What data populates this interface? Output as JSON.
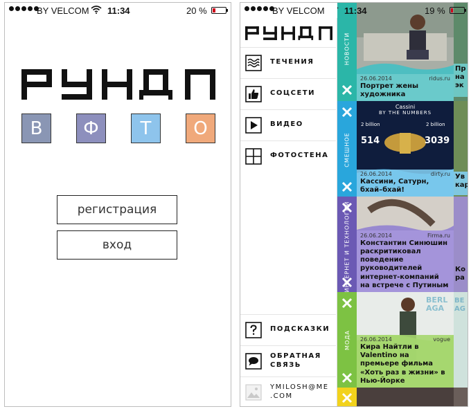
{
  "status_left": {
    "carrier": "BY VELCOM",
    "time": "11:34",
    "battery_pct": "20 %",
    "battery_level": 0.2,
    "battery_color": "#d0021b"
  },
  "status_right": {
    "carrier": "BY VELCOM",
    "time": "11:34",
    "battery_pct": "19 %"
  },
  "login": {
    "logo": "РУНДЛ",
    "social": [
      {
        "letter": "В",
        "color": "#8a96b4"
      },
      {
        "letter": "Ф",
        "color": "#8d8fbd"
      },
      {
        "letter": "Т",
        "color": "#8ec4ec"
      },
      {
        "letter": "О",
        "color": "#f0a97b"
      }
    ],
    "register_label": "регистрация",
    "login_label": "вход"
  },
  "menu": {
    "logo": "РУНДЛ",
    "items": [
      {
        "label": "ТЕЧЕНИЯ",
        "icon": "waves-icon"
      },
      {
        "label": "СОЦСЕТИ",
        "icon": "thumbs-up-icon"
      },
      {
        "label": "ВИДЕО",
        "icon": "play-icon"
      },
      {
        "label": "ФОТОСТЕНА",
        "icon": "photo-grid-icon"
      }
    ],
    "bottom": [
      {
        "label": "ПОДСКАЗКИ",
        "icon": "question-icon"
      },
      {
        "label": "ОБРАТНАЯ\nСВЯЗЬ",
        "icon": "chat-bubble-icon"
      },
      {
        "label": "YMILOSH@ME\n.COM",
        "icon": "avatar-placeholder-icon"
      }
    ]
  },
  "feed": {
    "sections": [
      {
        "name": "НОВОСТИ",
        "color": "#2bb6a8",
        "card": {
          "date": "26.06.2014",
          "source": "ridus.ru",
          "title": "Портрет жены художника"
        },
        "peek": "Пр\nна\nэк"
      },
      {
        "name": "СМЕШНОЕ",
        "color": "#29a6dc",
        "card": {
          "date": "26.06.2014",
          "source": "dirty.ru",
          "title": "Кассини, Сатурн, бхай–бхай!",
          "infographic": {
            "head": "Cassini",
            "sub": "BY THE NUMBERS",
            "n1": "514",
            "n2": "3039",
            "n3": "2 billion",
            "n4": "2 billion"
          }
        },
        "peek": "Ув\nкар"
      },
      {
        "name": "ИНТЕРНЕТ И ТЕХНОЛОГИИ",
        "color": "#6b59b4",
        "card": {
          "date": "26.06.2014",
          "source": "Firma.ru",
          "title": "Константин Синюшин раскритиковал поведение руководителей интернет-компаний на встрече с Путиным"
        },
        "peek": "Ко\nра"
      },
      {
        "name": "МОДА",
        "color": "#7dc243",
        "card": {
          "date": "26.06.2014",
          "source": "vogue",
          "title": "Кира Найтли в Valentino на премьере фильма «Хоть раз в жизни» в Нью-Йорке",
          "backdrop": "BERL\nAGA"
        },
        "peek": "BE\nAG"
      },
      {
        "name": "",
        "color": "#f2d21c",
        "card": null,
        "peek": ""
      }
    ]
  }
}
